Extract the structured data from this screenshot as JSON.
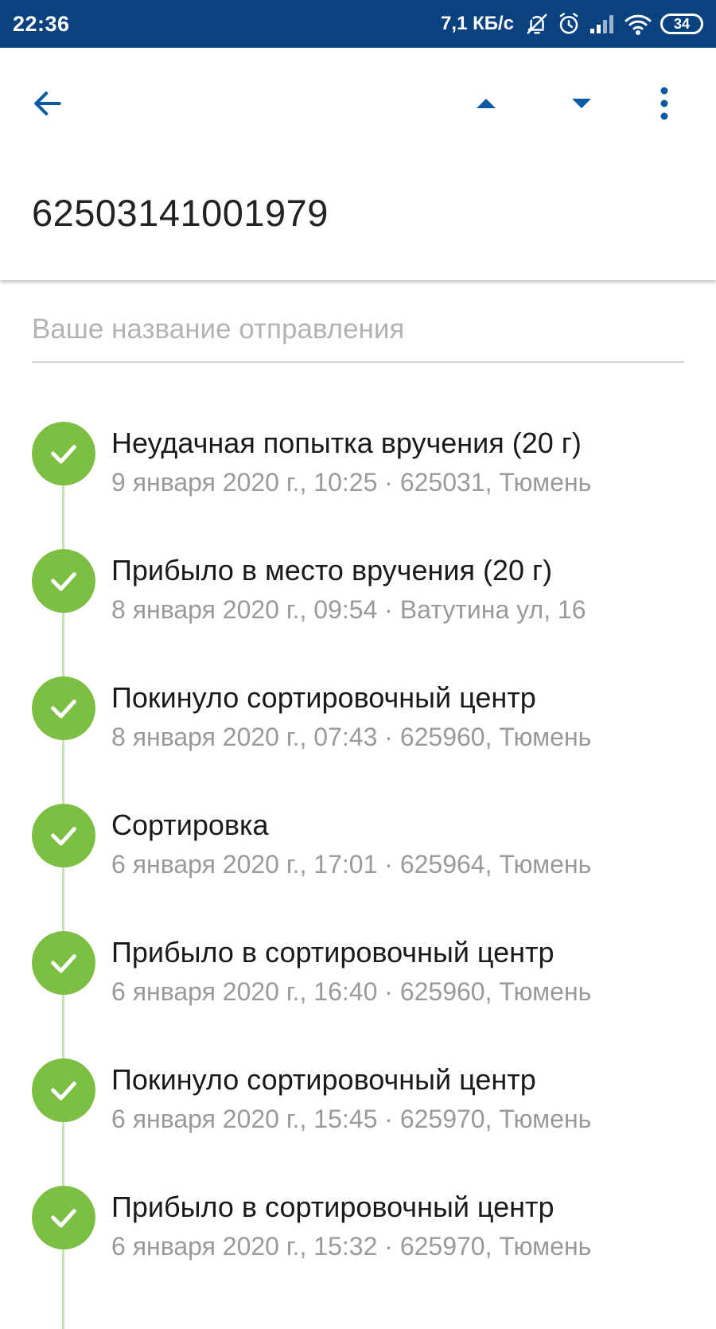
{
  "status_bar": {
    "time": "22:36",
    "speed": "7,1 КБ/с",
    "battery": "34",
    "icons": [
      "bell-off-icon",
      "alarm-icon",
      "signal-icon",
      "wifi-icon",
      "battery-icon"
    ]
  },
  "toolbar": {
    "icons": [
      "arrow-back-icon",
      "arrow-up-icon",
      "arrow-down-icon",
      "more-vert-icon"
    ],
    "tracking_number": "62503141001979"
  },
  "name_field": {
    "placeholder": "Ваше название отправления",
    "value": ""
  },
  "colors": {
    "status_bar": "#0a4281",
    "accent": "#0a5aa6",
    "check": "#7bc043",
    "timeline": "#c6e4ad",
    "meta_text": "#9a9a9a"
  },
  "events": [
    {
      "title": "Неудачная попытка вручения (20 г)",
      "meta": "9 января 2020 г., 10:25 · 625031, Тюмень"
    },
    {
      "title": "Прибыло в место вручения (20 г)",
      "meta": "8 января 2020 г., 09:54 · Ватутина ул, 16"
    },
    {
      "title": "Покинуло сортировочный центр",
      "meta": "8 января 2020 г., 07:43 · 625960, Тюмень"
    },
    {
      "title": "Сортировка",
      "meta": "6 января 2020 г., 17:01 · 625964, Тюмень"
    },
    {
      "title": "Прибыло в сортировочный центр",
      "meta": "6 января 2020 г., 16:40 · 625960, Тюмень"
    },
    {
      "title": "Покинуло сортировочный центр",
      "meta": "6 января 2020 г., 15:45 · 625970, Тюмень"
    },
    {
      "title": "Прибыло в сортировочный центр",
      "meta": "6 января 2020 г., 15:32 · 625970, Тюмень"
    }
  ]
}
